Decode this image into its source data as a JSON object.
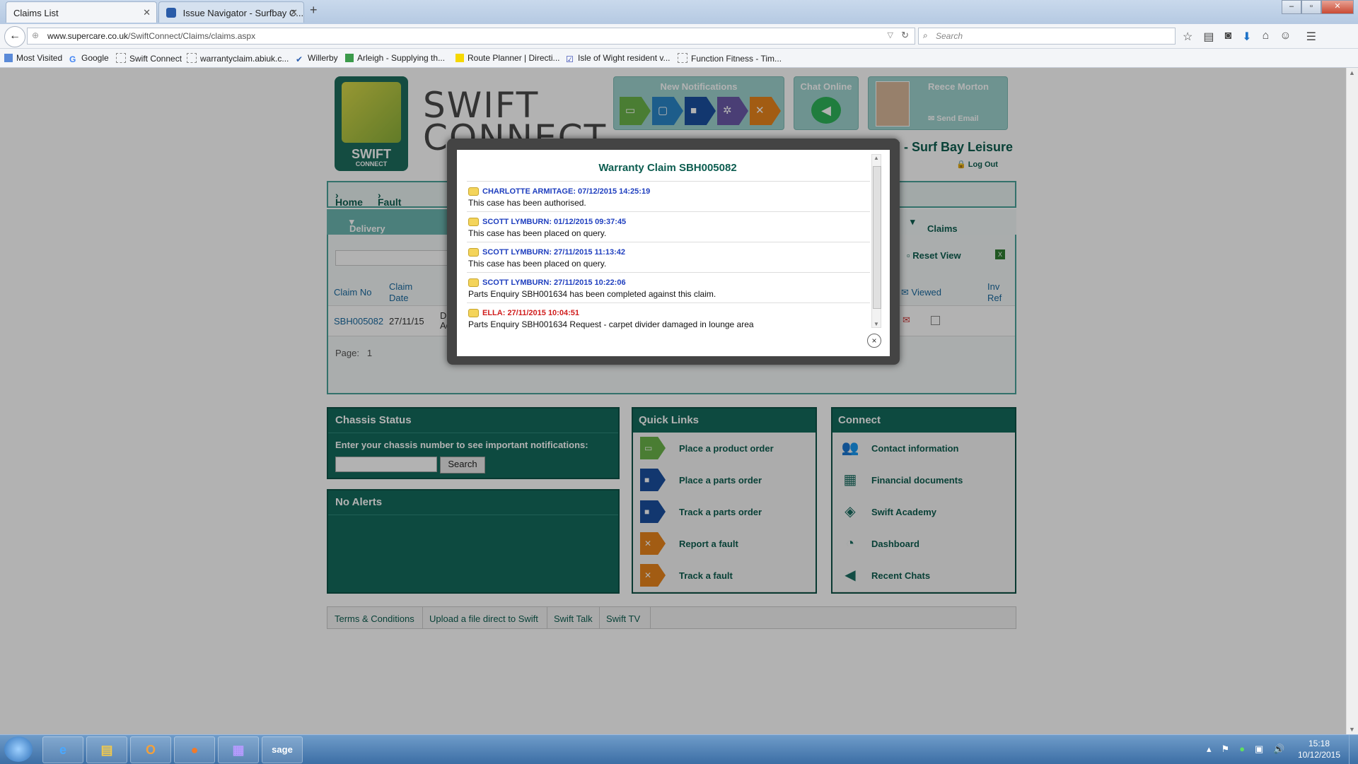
{
  "browser": {
    "tabs": [
      {
        "label": "Claims List",
        "active": true
      },
      {
        "label": "Issue Navigator - Surfbay C...",
        "active": false
      }
    ],
    "new_tab": "+",
    "url_host": "www.supercare.co.uk",
    "url_path": "/SwiftConnect/Claims/claims.aspx",
    "search_placeholder": "Search",
    "bookmarks": [
      "Most Visited",
      "Google",
      "Swift Connect",
      "warrantyclaim.abiuk.c...",
      "Willerby",
      "Arleigh - Supplying th...",
      "Route Planner | Directi...",
      "Isle of Wight resident v...",
      "Function Fitness - Tim..."
    ]
  },
  "site": {
    "logo_text": "SWIFT",
    "logo_sub": "CONNECT",
    "brand_line1": "SWIFT",
    "brand_line2": "CONNECT",
    "notifications_title": "New Notifications",
    "chat_title": "Chat Online",
    "user_name": "Reece Morton",
    "send_email": "Send Email",
    "dealer": "70SURFBH - Surf Bay Leisure",
    "logout": "Log Out",
    "breadcrumb": [
      "Home",
      "Fault Reporting"
    ],
    "menu": [
      "Delivery Acceptance",
      "Claims & Forms"
    ],
    "reset_view": "Reset View",
    "table": {
      "headers": [
        "Claim No",
        "Claim",
        "Date",
        "Viewed",
        "Inv",
        "Ref"
      ],
      "row": {
        "claim_no": "SBH005082",
        "date": "27/11/15",
        "col3a": "Deli",
        "col3b": "Acc"
      }
    },
    "page_label": "Page:",
    "page_num": "1"
  },
  "panels": {
    "chassis": {
      "title": "Chassis Status",
      "label": "Enter your chassis number to see important notifications:",
      "button": "Search"
    },
    "alerts": {
      "title": "No Alerts"
    },
    "quick_links": {
      "title": "Quick Links",
      "items": [
        "Place a product order",
        "Place a parts order",
        "Track a parts order",
        "Report a fault",
        "Track a fault"
      ]
    },
    "connect": {
      "title": "Connect",
      "items": [
        "Contact information",
        "Financial documents",
        "Swift Academy",
        "Dashboard",
        "Recent Chats"
      ]
    }
  },
  "footer": [
    "Terms & Conditions",
    "Upload a file direct to Swift",
    "Swift Talk",
    "Swift TV"
  ],
  "modal": {
    "title": "Warranty Claim SBH005082",
    "entries": [
      {
        "header": "CHARLOTTE ARMITAGE: 07/12/2015 14:25:19",
        "message": "This case has been authorised.",
        "color": "#1f3fbf"
      },
      {
        "header": "SCOTT LYMBURN: 01/12/2015 09:37:45",
        "message": "This case has been placed on query.",
        "color": "#1f3fbf"
      },
      {
        "header": "SCOTT LYMBURN: 27/11/2015 11:13:42",
        "message": "This case has been placed on query.",
        "color": "#1f3fbf"
      },
      {
        "header": "SCOTT LYMBURN: 27/11/2015 10:22:06",
        "message": "Parts Enquiry SBH001634 has been completed against this claim.",
        "color": "#1f3fbf"
      },
      {
        "header": "ELLA: 27/11/2015 10:04:51",
        "message": "Parts Enquiry SBH001634 Request - carpet divider damaged in lounge area",
        "color": "#d01c1c"
      }
    ],
    "close": "×"
  },
  "taskbar": {
    "time": "15:18",
    "date": "10/12/2015"
  }
}
